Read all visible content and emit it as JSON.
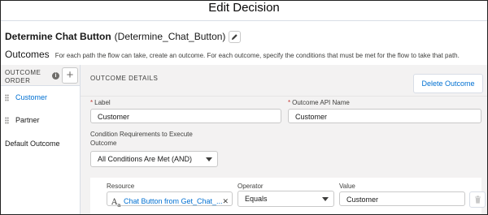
{
  "modal": {
    "title": "Edit Decision"
  },
  "decision": {
    "label": "Determine Chat Button",
    "api_name": "(Determine_Chat_Button)",
    "edit_icon": "pencil-icon"
  },
  "outcomes": {
    "title": "Outcomes",
    "help": "For each path the flow can take, create an outcome. For each outcome, specify the conditions that must be met for the flow to take that path."
  },
  "sidebar": {
    "header": "OUTCOME ORDER",
    "info_icon": "info-icon",
    "add_label": "+",
    "items": [
      {
        "label": "Customer",
        "active": true
      },
      {
        "label": "Partner",
        "active": false
      }
    ],
    "default_label": "Default Outcome"
  },
  "details": {
    "title": "OUTCOME DETAILS",
    "delete_label": "Delete Outcome",
    "label_field": {
      "label": "Label",
      "value": "Customer"
    },
    "api_field": {
      "label": "Outcome API Name",
      "value": "Customer"
    },
    "requirements": {
      "label": "Condition Requirements to Execute Outcome",
      "value": "All Conditions Are Met (AND)"
    },
    "condition": {
      "resource_label": "Resource",
      "resource_value": "Chat Button from Get_Chat_...",
      "operator_label": "Operator",
      "operator_value": "Equals",
      "value_label": "Value",
      "value_value": "Customer"
    }
  },
  "colors": {
    "link": "#0070d2",
    "required": "#c23934",
    "panel": "#f3f2f2"
  }
}
